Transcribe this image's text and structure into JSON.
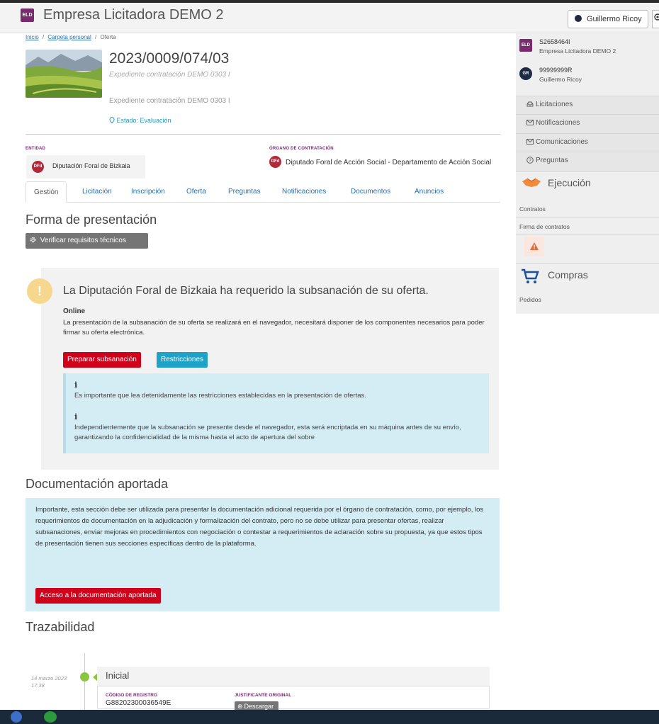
{
  "header": {
    "app_badge": "ELD",
    "app_title": "Empresa Licitadora DEMO 2",
    "user_button": "Guillermo Ricoy",
    "user_caret": "▾"
  },
  "breadcrumb": {
    "inicio": "Inicio",
    "sep1": "/",
    "carpeta": "Carpeta personal",
    "sep2": "/",
    "current": "Oferta"
  },
  "offer": {
    "id": "2023/0009/074/03",
    "expediente_italic": "Expediente contratación DEMO 0303 I",
    "expediente_plain": "Expediente contratación DEMO 0303 I",
    "estado": "Estado: Evaluación"
  },
  "entidad": {
    "label": "ENTIDAD",
    "logo": "DFd",
    "name": "Diputación Foral de Bizkaia"
  },
  "organo": {
    "label": "ÓRGANO DE CONTRATACIÓN",
    "logo": "DFd",
    "name": "Diputado Foral de Acción Social - Departamento de Acción Social"
  },
  "tabs": [
    "Gestión",
    "Licitación",
    "Inscripción",
    "Oferta",
    "Preguntas",
    "Notificaciones",
    "Documentos",
    "Anuncios"
  ],
  "forma": {
    "title": "Forma de presentación",
    "verify_button": "Verificar requisitos técnicos"
  },
  "alert": {
    "icon_glyph": "!",
    "title": "La Diputación Foral de Bizkaia ha requerido la subsanación de su oferta.",
    "mode_label": "Online",
    "mode_desc": "La presentación de la subsanación de su oferta se realizará en el navegador, necesitará disponer de los componentes necesarios para poder firmar su oferta electrónica.",
    "btn_preparar": "Preparar subsanación",
    "btn_restricciones": "Restricciones",
    "info_icon": "i",
    "info1": "Es importante que lea detenidamente las restricciones establecidas en la presentación de ofertas.",
    "info2": "Independientemente que la subsanación se presente desde el navegador, esta será encriptada en su máquina antes de su envío, garantizando la confidencialidad de la misma hasta el acto de apertura del sobre"
  },
  "documentacion": {
    "title": "Documentación aportada",
    "text": "Importante, esta sección debe ser utilizada para presentar la documentación adicional requerida por el órgano de contratación, como, por ejemplo, los requerimientos de documentación en la adjudicación y formalización del contrato, pero no se debe utilizar para presentar ofertas, realizar subsanaciones, enviar mejoras en procedimientos con negociación o contestar a requerimientos de aclaración sobre su propuesta, ya que estos tipos de presentación tienen sus secciones específicas dentro de la plataforma.",
    "button": "Acceso a la documentación aportada"
  },
  "trazabilidad": {
    "title": "Trazabilidad",
    "date": "14 marzo 2023",
    "time": "17:38",
    "card_title": "Inicial",
    "codigo_label": "CÓDIGO DE REGISTRO",
    "codigo_value": "G88202300036549E",
    "justificante_label": "JUSTIFICANTE ORIGINAL",
    "descargar": "Descargar"
  },
  "sidebar": {
    "acc1_badge": "ELD",
    "acc1_id": "S2658464I",
    "acc1_name": "Empresa Licitadora DEMO 2",
    "acc2_badge": "GR",
    "acc2_id": "99999999R",
    "acc2_name": "Guillermo Ricoy",
    "menu": [
      "Licitaciones",
      "Notificaciones",
      "Comunicaciones",
      "Preguntas"
    ],
    "ejecucion_title": "Ejecución",
    "ejecucion_items": [
      "Contratos",
      "Firma de contratos"
    ],
    "compras_title": "Compras",
    "compras_items": [
      "Pedidos"
    ]
  },
  "colors": {
    "brand_purple": "#7a2a6e",
    "danger_red": "#d0021b",
    "info_blue": "#1fa2c7",
    "info_bg": "#d4ecf4",
    "status_green": "#8cc63f"
  },
  "icons": {
    "estado": "location-pin-icon",
    "verify": "gear-icon",
    "licitaciones": "inbox-icon",
    "notificaciones": "envelope-icon",
    "comunicaciones": "envelope-icon",
    "preguntas": "question-circle-icon",
    "ejecucion": "handshake-icon",
    "compras": "shopping-cart-icon",
    "warning": "warning-triangle-icon",
    "descargar": "download-icon"
  }
}
